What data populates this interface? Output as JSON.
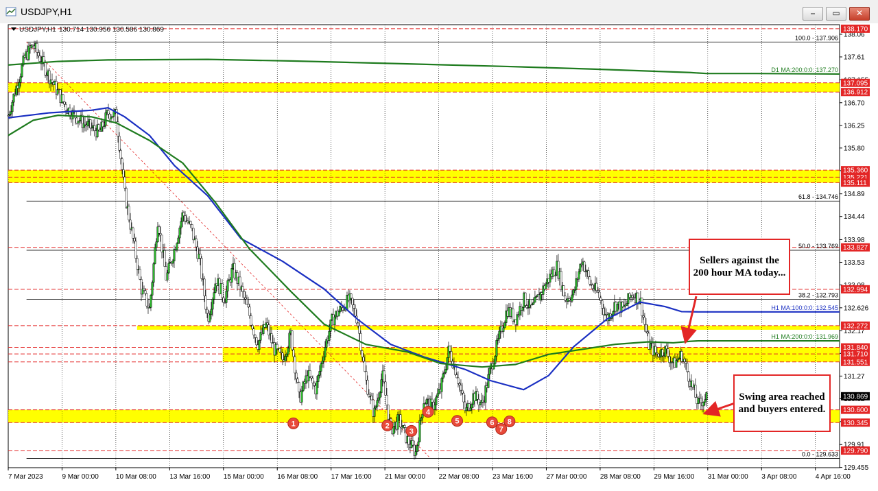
{
  "window": {
    "title": "USDJPY,H1",
    "buttons": [
      "⎯",
      "▭",
      "✕"
    ]
  },
  "chart_data": {
    "type": "candlestick",
    "symbol_info": "USDJPY,H1",
    "ohlc": "130.714 130.956 130.586 130.869",
    "ylim": [
      129.45,
      138.25
    ],
    "y_ticks": [
      138.06,
      137.61,
      137.155,
      136.7,
      136.25,
      135.8,
      135.35,
      134.89,
      134.44,
      133.98,
      133.53,
      133.08,
      132.626,
      132.17,
      131.721,
      131.27,
      130.82,
      130.365,
      129.91,
      129.455
    ],
    "x_ticks": [
      "7 Mar 2023",
      "9 Mar 00:00",
      "10 Mar 08:00",
      "13 Mar 16:00",
      "15 Mar 00:00",
      "16 Mar 08:00",
      "17 Mar 16:00",
      "21 Mar 00:00",
      "22 Mar 08:00",
      "23 Mar 16:00",
      "27 Mar 00:00",
      "28 Mar 08:00",
      "29 Mar 16:00",
      "31 Mar 00:00",
      "3 Apr 08:00",
      "4 Apr 16:00"
    ],
    "price_tags": [
      {
        "label": "138.170",
        "value": 138.17,
        "color": "#e32626"
      },
      {
        "label": "137.095",
        "value": 137.095,
        "color": "#e32626"
      },
      {
        "label": "136.912",
        "value": 136.912,
        "color": "#e32626"
      },
      {
        "label": "135.360",
        "value": 135.36,
        "color": "#e32626"
      },
      {
        "label": "135.221",
        "value": 135.221,
        "color": "#e32626"
      },
      {
        "label": "135.111",
        "value": 135.111,
        "color": "#e32626"
      },
      {
        "label": "133.827",
        "value": 133.827,
        "color": "#e32626"
      },
      {
        "label": "132.994",
        "value": 132.994,
        "color": "#e32626"
      },
      {
        "label": "132.272",
        "value": 132.272,
        "color": "#e32626"
      },
      {
        "label": "131.840",
        "value": 131.84,
        "color": "#e32626"
      },
      {
        "label": "131.710",
        "value": 131.71,
        "color": "#e32626"
      },
      {
        "label": "131.551",
        "value": 131.551,
        "color": "#e32626"
      },
      {
        "label": "130.869",
        "value": 130.869,
        "color": "#000000"
      },
      {
        "label": "130.600",
        "value": 130.6,
        "color": "#e32626"
      },
      {
        "label": "130.345",
        "value": 130.345,
        "color": "#e32626"
      },
      {
        "label": "129.790",
        "value": 129.79,
        "color": "#e32626"
      }
    ],
    "zones": [
      {
        "from": 137.095,
        "to": 136.912
      },
      {
        "from": 135.36,
        "to": 135.111
      },
      {
        "from": 132.272,
        "to": 132.19,
        "start": 0.155
      },
      {
        "from": 131.84,
        "to": 131.551,
        "start": 0.258
      },
      {
        "from": 130.6,
        "to": 130.345
      }
    ],
    "fib_levels": [
      {
        "label": "100.0 - 137.906",
        "value": 137.906
      },
      {
        "label": "61.8 - 134.746",
        "value": 134.746
      },
      {
        "label": "50.0 - 133.769",
        "value": 133.769
      },
      {
        "label": "38.2 - 132.793",
        "value": 132.793
      },
      {
        "label": "0.0 - 129.633",
        "value": 129.633
      }
    ],
    "dashed_levels": [
      138.17,
      129.79
    ],
    "ma_labels": [
      {
        "label": "D1 MA:200:0:0: 137.270",
        "value": 137.27,
        "color": "#1e7b1e"
      },
      {
        "label": "H1 MA:100:0:0: 132.545",
        "value": 132.545,
        "color": "#1a2fc2"
      },
      {
        "label": "H1 MA:200:0:0: 131.969",
        "value": 131.969,
        "color": "#1e7b1e"
      }
    ],
    "series": [
      {
        "name": "D1 MA 200",
        "color": "#1e7b1e",
        "x": [
          0.0,
          0.06,
          0.12,
          0.24,
          0.34,
          0.46,
          0.6,
          0.7,
          0.82,
          0.84,
          0.9,
          1.0
        ],
        "y": [
          137.45,
          137.52,
          137.55,
          137.56,
          137.53,
          137.48,
          137.42,
          137.37,
          137.3,
          137.28,
          137.28,
          137.27
        ]
      },
      {
        "name": "H1 MA 100",
        "color": "#1a2fc2",
        "x": [
          0.0,
          0.05,
          0.1,
          0.12,
          0.14,
          0.17,
          0.2,
          0.24,
          0.28,
          0.33,
          0.38,
          0.42,
          0.46,
          0.5,
          0.55,
          0.58,
          0.62,
          0.65,
          0.68,
          0.72,
          0.76,
          0.79,
          0.81,
          0.83,
          1.0
        ],
        "y": [
          136.4,
          136.5,
          136.55,
          136.6,
          136.42,
          136.05,
          135.45,
          134.85,
          134.0,
          133.55,
          133.0,
          132.4,
          131.9,
          131.65,
          131.4,
          131.18,
          131.0,
          131.28,
          131.85,
          132.4,
          132.74,
          132.65,
          132.55,
          132.545,
          132.545
        ]
      },
      {
        "name": "H1 MA 200",
        "color": "#1e7b1e",
        "x": [
          0.0,
          0.03,
          0.06,
          0.1,
          0.13,
          0.17,
          0.21,
          0.25,
          0.29,
          0.34,
          0.38,
          0.43,
          0.48,
          0.52,
          0.57,
          0.61,
          0.65,
          0.69,
          0.73,
          0.77,
          0.8,
          0.82,
          0.83,
          1.0
        ],
        "y": [
          136.05,
          136.35,
          136.45,
          136.42,
          136.3,
          135.95,
          135.5,
          134.7,
          133.8,
          132.95,
          132.3,
          131.9,
          131.75,
          131.52,
          131.45,
          131.5,
          131.7,
          131.8,
          131.9,
          131.95,
          131.93,
          131.96,
          131.969,
          131.969
        ]
      }
    ],
    "path": {
      "x": [
        0.0,
        0.02,
        0.03,
        0.05,
        0.07,
        0.09,
        0.11,
        0.12,
        0.13,
        0.14,
        0.15,
        0.16,
        0.17,
        0.18,
        0.19,
        0.2,
        0.21,
        0.22,
        0.23,
        0.24,
        0.25,
        0.26,
        0.27,
        0.28,
        0.29,
        0.3,
        0.31,
        0.32,
        0.33,
        0.34,
        0.35,
        0.36,
        0.37,
        0.38,
        0.39,
        0.4,
        0.41,
        0.42,
        0.43,
        0.44,
        0.45,
        0.46,
        0.47,
        0.48,
        0.49,
        0.5,
        0.51,
        0.52,
        0.53,
        0.54,
        0.55,
        0.56,
        0.57,
        0.58,
        0.59,
        0.6,
        0.61,
        0.62,
        0.63,
        0.64,
        0.65,
        0.66,
        0.67,
        0.68,
        0.69,
        0.7,
        0.71,
        0.72,
        0.73,
        0.74,
        0.75,
        0.76,
        0.77,
        0.78,
        0.79,
        0.8,
        0.81,
        0.82,
        0.83,
        0.84
      ],
      "y": [
        136.45,
        137.6,
        137.85,
        137.2,
        136.6,
        136.3,
        136.1,
        136.5,
        136.45,
        134.9,
        134.0,
        133.0,
        132.6,
        134.4,
        133.2,
        133.8,
        134.5,
        134.2,
        133.6,
        132.4,
        133.2,
        132.8,
        133.4,
        133.0,
        132.5,
        131.9,
        132.3,
        131.8,
        131.6,
        132.1,
        130.8,
        131.3,
        131.0,
        131.8,
        132.4,
        132.6,
        132.8,
        132.4,
        131.2,
        130.5,
        131.3,
        130.2,
        130.4,
        130.0,
        129.75,
        130.8,
        130.65,
        131.0,
        131.8,
        131.3,
        130.55,
        130.9,
        130.7,
        131.4,
        132.0,
        132.6,
        132.4,
        132.8,
        132.6,
        132.9,
        133.2,
        133.45,
        132.8,
        132.9,
        133.6,
        133.1,
        132.9,
        132.4,
        132.7,
        132.6,
        132.9,
        132.8,
        131.9,
        131.7,
        131.8,
        131.5,
        131.7,
        131.2,
        130.7,
        130.869
      ]
    },
    "swing_markers": [
      {
        "label": "1",
        "x": 0.343,
        "value": 130.33
      },
      {
        "label": "2",
        "x": 0.456,
        "value": 130.29
      },
      {
        "label": "3",
        "x": 0.485,
        "value": 130.18
      },
      {
        "label": "4",
        "x": 0.505,
        "value": 130.56
      },
      {
        "label": "5",
        "x": 0.54,
        "value": 130.38
      },
      {
        "label": "6",
        "x": 0.582,
        "value": 130.35
      },
      {
        "label": "7",
        "x": 0.593,
        "value": 130.22
      },
      {
        "label": "8",
        "x": 0.603,
        "value": 130.37
      }
    ]
  },
  "annotations": {
    "sellers": "Sellers against the 200 hour MA today...",
    "swing": "Swing area reached and buyers entered."
  }
}
